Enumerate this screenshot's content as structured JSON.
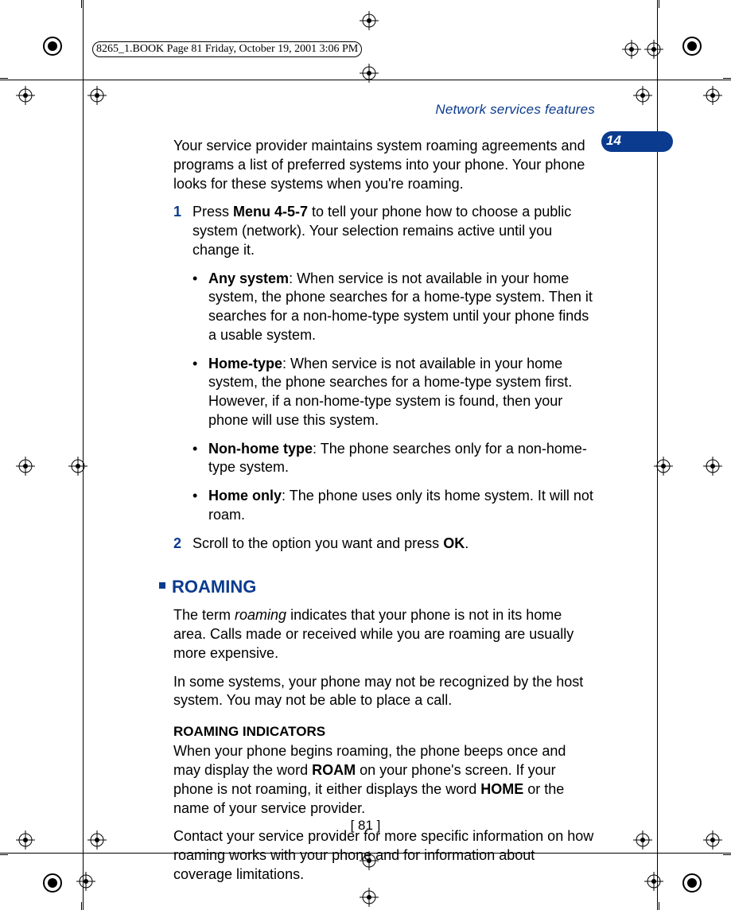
{
  "meta": {
    "book_label": "8265_1.BOOK  Page 81  Friday, October 19, 2001  3:06 PM"
  },
  "header": {
    "title": "Network services features",
    "chapter_number": "14"
  },
  "intro": "Your service provider maintains system roaming agreements and programs a list of preferred systems into your phone.  Your phone looks for these systems when you're roaming.",
  "steps": [
    {
      "num": "1",
      "pre": "Press ",
      "bold1": "Menu 4-5-7",
      "post1": " to tell your phone how to choose a public system (network). Your selection remains active until you change it."
    },
    {
      "num": "2",
      "pre": "Scroll to the option you want and press ",
      "bold1": "OK",
      "post1": "."
    }
  ],
  "options": [
    {
      "label": "Any system",
      "text": ": When service is not available in your home system, the phone searches for a home-type system. Then it searches for a non-home-type system until your phone finds a usable system."
    },
    {
      "label": "Home-type",
      "text": ": When service is not available in your home system, the phone searches for a home-type system first. However, if a non-home-type system is found, then your phone will use this system."
    },
    {
      "label": "Non-home type",
      "text": ": The phone searches only for a non-home-type system."
    },
    {
      "label": "Home only",
      "text": ": The phone uses only its home system. It will not roam."
    }
  ],
  "roaming": {
    "heading": "ROAMING",
    "p1_pre": "The term ",
    "p1_em": "roaming",
    "p1_post": " indicates that your phone is not in its home area. Calls made or received while you are roaming are usually more expensive.",
    "p2": "In some systems, your phone may not be recognized by the host system. You may not be able to place a call.",
    "indicators_heading": "ROAMING INDICATORS",
    "ind_p1_a": "When your phone begins roaming, the phone beeps once and may display the word ",
    "ind_p1_b": "ROAM",
    "ind_p1_c": " on your phone's screen. If your phone is not roaming, it either displays the word ",
    "ind_p1_d": "HOME",
    "ind_p1_e": " or the name of your service provider.",
    "ind_p2": "Contact your service provider for more specific information on how roaming works with your phone and for information about coverage limitations."
  },
  "page_number": "[ 81 ]"
}
